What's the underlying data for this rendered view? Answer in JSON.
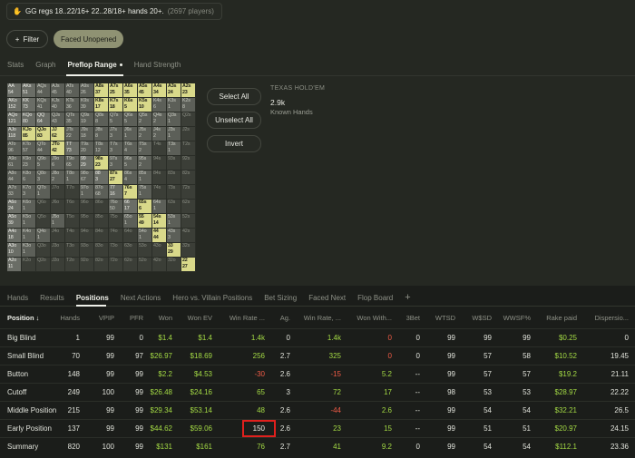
{
  "query": {
    "icon": "hand-icon",
    "text": "GG regs 18..22/16+ 22..28/18+ hands 20+.",
    "count": "(2697 players)"
  },
  "filter_button": {
    "icon": "plus-icon",
    "label": "Filter"
  },
  "active_filter": "Faced Unopened",
  "top_tabs": [
    "Stats",
    "Graph",
    "Preflop Range",
    "Hand Strength"
  ],
  "top_tabs_active": "Preflop Range",
  "range_grid": [
    [
      [
        "AA",
        "54"
      ],
      [
        "AKs",
        "51"
      ],
      [
        "AQs",
        "44"
      ],
      [
        "AJs",
        "45"
      ],
      [
        "ATs",
        "40"
      ],
      [
        "A9s",
        "26"
      ],
      [
        "A8s",
        "37"
      ],
      [
        "A7s",
        "25"
      ],
      [
        "A6s",
        "35"
      ],
      [
        "A5s",
        "45"
      ],
      [
        "A4s",
        "34"
      ],
      [
        "A3s",
        "24"
      ],
      [
        "A2s",
        "23"
      ]
    ],
    [
      [
        "AKo",
        "152"
      ],
      [
        "KK",
        "73"
      ],
      [
        "KQs",
        "41"
      ],
      [
        "KJs",
        "40"
      ],
      [
        "KTs",
        "36"
      ],
      [
        "K9s",
        "39"
      ],
      [
        "K8s",
        "17"
      ],
      [
        "K7s",
        "18"
      ],
      [
        "K6s",
        "5"
      ],
      [
        "K5s",
        "10"
      ],
      [
        "K4s",
        "6"
      ],
      [
        "K3s",
        "1"
      ],
      [
        "K2s",
        "8"
      ]
    ],
    [
      [
        "AQo",
        "121"
      ],
      [
        "KQo",
        "80"
      ],
      [
        "QQ",
        "64"
      ],
      [
        "QJs",
        "43"
      ],
      [
        "QTs",
        "35"
      ],
      [
        "Q9s",
        "19"
      ],
      [
        "Q8s",
        "8"
      ],
      [
        "Q7s",
        "5"
      ],
      [
        "Q6s",
        "5"
      ],
      [
        "Q5s",
        "2"
      ],
      [
        "Q4s",
        "2"
      ],
      [
        "Q3s",
        "1"
      ],
      [
        "Q2s",
        ""
      ]
    ],
    [
      [
        "AJo",
        "118"
      ],
      [
        "KJo",
        "85"
      ],
      [
        "QJo",
        "83"
      ],
      [
        "JJ",
        "62"
      ],
      [
        "JTs",
        "22"
      ],
      [
        "J9s",
        "18"
      ],
      [
        "J8s",
        "8"
      ],
      [
        "J7s",
        "3"
      ],
      [
        "J6s",
        "1"
      ],
      [
        "J5s",
        "2"
      ],
      [
        "J4s",
        "2"
      ],
      [
        "J3s",
        "1"
      ],
      [
        "J2s",
        ""
      ]
    ],
    [
      [
        "ATo",
        "96"
      ],
      [
        "KTo",
        "57"
      ],
      [
        "QTo",
        "44"
      ],
      [
        "JTo",
        "42"
      ],
      [
        "TT",
        "73"
      ],
      [
        "T9s",
        "20"
      ],
      [
        "T8s",
        "12"
      ],
      [
        "T7s",
        "3"
      ],
      [
        "T6s",
        "4"
      ],
      [
        "T5s",
        "2"
      ],
      [
        "T4s",
        ""
      ],
      [
        "T3s",
        "1"
      ],
      [
        "T2s",
        ""
      ]
    ],
    [
      [
        "A9o",
        "61"
      ],
      [
        "K9o",
        "23"
      ],
      [
        "Q9o",
        "5"
      ],
      [
        "J9o",
        "6"
      ],
      [
        "T9o",
        "65"
      ],
      [
        "99",
        "29"
      ],
      [
        "98s",
        "23"
      ],
      [
        "97s",
        "3"
      ],
      [
        "96s",
        "5"
      ],
      [
        "95s",
        "2"
      ],
      [
        "94s",
        ""
      ],
      [
        "93s",
        ""
      ],
      [
        "92s",
        ""
      ]
    ],
    [
      [
        "A8o",
        "44"
      ],
      [
        "K8o",
        "6"
      ],
      [
        "Q8o",
        "3"
      ],
      [
        "J8o",
        "2"
      ],
      [
        "T8o",
        "1"
      ],
      [
        "98o",
        "67"
      ],
      [
        "88",
        "3"
      ],
      [
        "87s",
        "27"
      ],
      [
        "86s",
        "4"
      ],
      [
        "85s",
        "1"
      ],
      [
        "84s",
        ""
      ],
      [
        "83s",
        ""
      ],
      [
        "82s",
        ""
      ]
    ],
    [
      [
        "A7o",
        "33"
      ],
      [
        "K7o",
        "3"
      ],
      [
        "Q7o",
        "1"
      ],
      [
        "J7o",
        ""
      ],
      [
        "T7o",
        ""
      ],
      [
        "97o",
        "1"
      ],
      [
        "87o",
        "68"
      ],
      [
        "77",
        "16"
      ],
      [
        "76s",
        "7"
      ],
      [
        "75s",
        "1"
      ],
      [
        "74s",
        ""
      ],
      [
        "73s",
        ""
      ],
      [
        "72s",
        ""
      ]
    ],
    [
      [
        "A6o",
        "24"
      ],
      [
        "K6o",
        "1"
      ],
      [
        "Q6o",
        ""
      ],
      [
        "J6o",
        ""
      ],
      [
        "T6o",
        ""
      ],
      [
        "96o",
        ""
      ],
      [
        "86o",
        ""
      ],
      [
        "76o",
        "50"
      ],
      [
        "66",
        "17"
      ],
      [
        "65s",
        "6"
      ],
      [
        "64s",
        "1"
      ],
      [
        "63s",
        ""
      ],
      [
        "62s",
        ""
      ]
    ],
    [
      [
        "A5o",
        "39"
      ],
      [
        "K5o",
        "1"
      ],
      [
        "Q5o",
        ""
      ],
      [
        "J5o",
        "1"
      ],
      [
        "T5o",
        ""
      ],
      [
        "95o",
        ""
      ],
      [
        "85o",
        ""
      ],
      [
        "75o",
        ""
      ],
      [
        "65o",
        "1"
      ],
      [
        "55",
        "49"
      ],
      [
        "54s",
        "14"
      ],
      [
        "53s",
        "1"
      ],
      [
        "52s",
        ""
      ]
    ],
    [
      [
        "A4o",
        "18"
      ],
      [
        "K4o",
        "1"
      ],
      [
        "Q4o",
        "1"
      ],
      [
        "J4o",
        ""
      ],
      [
        "T4o",
        ""
      ],
      [
        "94o",
        ""
      ],
      [
        "84o",
        ""
      ],
      [
        "74o",
        ""
      ],
      [
        "64o",
        ""
      ],
      [
        "54o",
        "1"
      ],
      [
        "44",
        "44"
      ],
      [
        "43s",
        "3"
      ],
      [
        "42s",
        ""
      ]
    ],
    [
      [
        "A3o",
        "10"
      ],
      [
        "K3o",
        "1"
      ],
      [
        "Q3o",
        ""
      ],
      [
        "J3o",
        ""
      ],
      [
        "T3o",
        ""
      ],
      [
        "93o",
        ""
      ],
      [
        "83o",
        ""
      ],
      [
        "73o",
        ""
      ],
      [
        "63o",
        ""
      ],
      [
        "53o",
        ""
      ],
      [
        "43o",
        ""
      ],
      [
        "33",
        "29"
      ],
      [
        "32s",
        ""
      ]
    ],
    [
      [
        "A2o",
        "11"
      ],
      [
        "K2o",
        ""
      ],
      [
        "Q2o",
        ""
      ],
      [
        "J2o",
        ""
      ],
      [
        "T2o",
        ""
      ],
      [
        "92o",
        ""
      ],
      [
        "82o",
        ""
      ],
      [
        "72o",
        ""
      ],
      [
        "62o",
        ""
      ],
      [
        "52o",
        ""
      ],
      [
        "42o",
        ""
      ],
      [
        "32o",
        ""
      ],
      [
        "22",
        "27"
      ]
    ]
  ],
  "range_highlight": [
    "A8s",
    "A7s",
    "A6s",
    "A5s",
    "A4s",
    "A3s",
    "A2s",
    "K8s",
    "K7s",
    "K6s",
    "K5s",
    "KJo",
    "QJo",
    "JJ",
    "JTo",
    "98s",
    "87s",
    "76s",
    "65s",
    "55",
    "54s",
    "44",
    "33",
    "22"
  ],
  "range_dark": [
    "AA",
    "AKs",
    "AKo",
    "KK",
    "AQo",
    "KQo",
    "QQ",
    "AJo",
    "TT",
    "99",
    "88",
    "77",
    "66",
    "A6o",
    "A5o",
    "A4o",
    "A3o",
    "A2o"
  ],
  "actions": {
    "select_all": "Select All",
    "unselect_all": "Unselect All",
    "invert": "Invert"
  },
  "info": {
    "game": "TEXAS HOLD'EM",
    "count": "2.9k",
    "label": "Known Hands"
  },
  "bottom_tabs": [
    "Hands",
    "Results",
    "Positions",
    "Next Actions",
    "Hero vs. Villain Positions",
    "Bet Sizing",
    "Faced Next",
    "Flop Board"
  ],
  "bottom_tabs_active": "Positions",
  "add_tab_icon": "plus-icon",
  "table": {
    "headers": [
      "Position ↓",
      "Hands",
      "VPIP",
      "PFR",
      "Won",
      "Won EV",
      "Win Rate ...",
      "Ag.",
      "Win Rate, ...",
      "Won With...",
      "3Bet",
      "WTSD",
      "W$SD",
      "WWSF%",
      "Rake paid",
      "Dispersio..."
    ],
    "rows": [
      [
        "Big Blind",
        "1",
        "99",
        "0",
        "$1.4",
        "$1.4",
        "1.4k",
        "0",
        "1.4k",
        "0",
        "0",
        "99",
        "99",
        "99",
        "$0.25",
        "0"
      ],
      [
        "Small Blind",
        "70",
        "99",
        "97",
        "$26.97",
        "$18.69",
        "256",
        "2.7",
        "325",
        "0",
        "0",
        "99",
        "57",
        "58",
        "$10.52",
        "19.45"
      ],
      [
        "Button",
        "148",
        "99",
        "99",
        "$2.2",
        "$4.53",
        "-30",
        "2.6",
        "-15",
        "5.2",
        "--",
        "99",
        "57",
        "57",
        "$19.2",
        "21.11"
      ],
      [
        "Cutoff",
        "249",
        "100",
        "99",
        "$26.48",
        "$24.16",
        "65",
        "3",
        "72",
        "17",
        "--",
        "98",
        "53",
        "53",
        "$28.97",
        "22.22"
      ],
      [
        "Middle Position",
        "215",
        "99",
        "99",
        "$29.34",
        "$53.14",
        "48",
        "2.6",
        "-44",
        "2.6",
        "--",
        "99",
        "54",
        "54",
        "$32.21",
        "26.5"
      ],
      [
        "Early Position",
        "137",
        "99",
        "99",
        "$44.62",
        "$59.06",
        "150",
        "2.6",
        "23",
        "15",
        "--",
        "99",
        "51",
        "51",
        "$20.97",
        "24.15"
      ],
      [
        "Summary",
        "820",
        "100",
        "99",
        "$131",
        "$161",
        "76",
        "2.7",
        "41",
        "9.2",
        "0",
        "99",
        "54",
        "54",
        "$112.1",
        "23.36"
      ]
    ],
    "highlighted_cell": {
      "row": 5,
      "col": 6
    }
  },
  "colors": {
    "accent": "#a3d944",
    "negative": "#ef5b46",
    "highlight_cell": "#d9d98a",
    "highlight_outline": "#e0201d"
  }
}
